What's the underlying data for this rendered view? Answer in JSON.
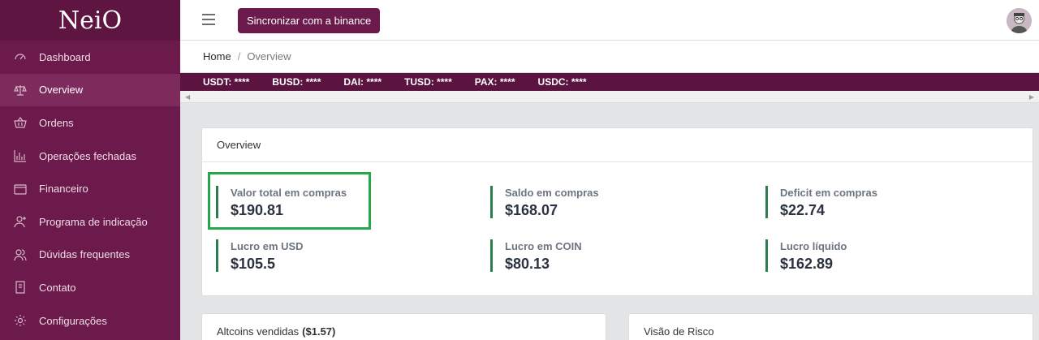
{
  "brand": "NeiO",
  "sidebar": {
    "items": [
      {
        "label": "Dashboard",
        "icon": "dashboard-icon",
        "active": false
      },
      {
        "label": "Overview",
        "icon": "balance-scale-icon",
        "active": true
      },
      {
        "label": "Ordens",
        "icon": "basket-icon",
        "active": false
      },
      {
        "label": "Operações fechadas",
        "icon": "bar-chart-icon",
        "active": false
      },
      {
        "label": "Financeiro",
        "icon": "wallet-icon",
        "active": false
      },
      {
        "label": "Programa de indicação",
        "icon": "user-add-icon",
        "active": false
      },
      {
        "label": "Dúvidas frequentes",
        "icon": "users-icon",
        "active": false
      },
      {
        "label": "Contato",
        "icon": "book-icon",
        "active": false
      },
      {
        "label": "Configurações",
        "icon": "gear-icon",
        "active": false
      }
    ]
  },
  "header": {
    "sync_label": "Sincronizar com a binance"
  },
  "breadcrumb": {
    "home": "Home",
    "sep": "/",
    "current": "Overview"
  },
  "ticker": [
    {
      "label": "USDT: ****"
    },
    {
      "label": "BUSD: ****"
    },
    {
      "label": "DAI: ****"
    },
    {
      "label": "TUSD: ****"
    },
    {
      "label": "PAX: ****"
    },
    {
      "label": "USDC: ****"
    }
  ],
  "overview": {
    "title": "Overview",
    "stats": [
      {
        "label": "Valor total em compras",
        "value": "$190.81"
      },
      {
        "label": "Saldo em compras",
        "value": "$168.07"
      },
      {
        "label": "Deficit em compras",
        "value": "$22.74"
      },
      {
        "label": "Lucro em USD",
        "value": "$105.5"
      },
      {
        "label": "Lucro em COIN",
        "value": "$80.13"
      },
      {
        "label": "Lucro líquido",
        "value": "$162.89"
      }
    ]
  },
  "altcoins": {
    "title": "Altcoins vendidas",
    "amount": "($1.57)"
  },
  "risk": {
    "title": "Visão de Risco"
  },
  "colors": {
    "sidebar": "#6b1a4b",
    "accent": "#6b1a4b",
    "stat_border": "#2e7d4e",
    "highlight": "#23a84a"
  }
}
